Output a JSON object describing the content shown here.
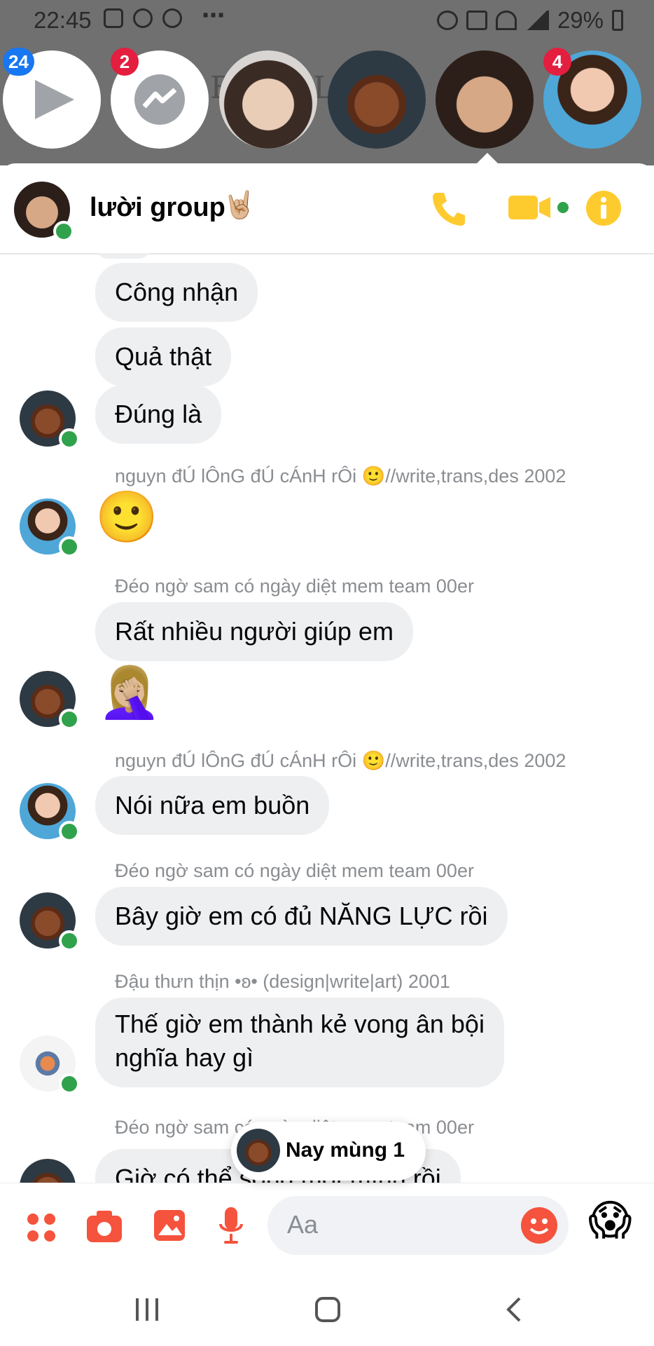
{
  "status_bar": {
    "time": "22:45",
    "battery": "29%"
  },
  "background_hint": "EN  H  L",
  "chat_heads": [
    {
      "id": "video",
      "badge": "24",
      "icon": "play-icon"
    },
    {
      "id": "messenger",
      "badge": "2",
      "icon": "messenger-icon"
    },
    {
      "id": "contact-boy",
      "badge": ""
    },
    {
      "id": "contact-mouse",
      "badge": ""
    },
    {
      "id": "contact-selfie",
      "badge": ""
    },
    {
      "id": "contact-girl",
      "badge": "4"
    }
  ],
  "conversation": {
    "title": "lười group",
    "title_emoji": "🤘🏼"
  },
  "messages": [
    {
      "type": "bubble",
      "text": "Công nhận"
    },
    {
      "type": "bubble",
      "text": "Quả thật"
    },
    {
      "type": "bubble",
      "text": "Đúng là"
    },
    {
      "type": "sender",
      "text": "nguyn đÚ lÔnG đÚ cÁnH rÔi 🙂//write,trans,des 2002"
    },
    {
      "type": "emoji",
      "text": "🙂"
    },
    {
      "type": "sender",
      "text": "Đéo ngờ sam có ngày diệt mem team 00er"
    },
    {
      "type": "bubble",
      "text": "Rất nhiều người giúp em"
    },
    {
      "type": "emoji",
      "text": "🤦🏼‍♀️"
    },
    {
      "type": "sender",
      "text": "nguyn đÚ lÔnG đÚ cÁnH rÔi 🙂//write,trans,des 2002"
    },
    {
      "type": "bubble",
      "text": "Nói nữa em buồn"
    },
    {
      "type": "sender",
      "text": "Đéo ngờ sam có ngày diệt mem team 00er"
    },
    {
      "type": "bubble",
      "text": "Bây giờ em có đủ NĂNG LỰC rồi"
    },
    {
      "type": "sender",
      "text": "Đậu thưn thịn •ʚ• (design|write|art) 2001"
    },
    {
      "type": "bubble",
      "text": "Thế giờ em thành kẻ vong ân bội nghĩa hay gì",
      "line1": "Thế giờ em thành kẻ vong ân bội",
      "line2": "nghĩa hay gì"
    },
    {
      "type": "sender",
      "text": "Đéo ngờ sam có ngày diệt mem team 00er"
    },
    {
      "type": "bubble",
      "text": "Giờ có thể sống một mình rồi"
    }
  ],
  "toast": {
    "label": "Nay mùng 1"
  },
  "composer": {
    "placeholder": "Aa",
    "quick_reaction": "😱"
  }
}
